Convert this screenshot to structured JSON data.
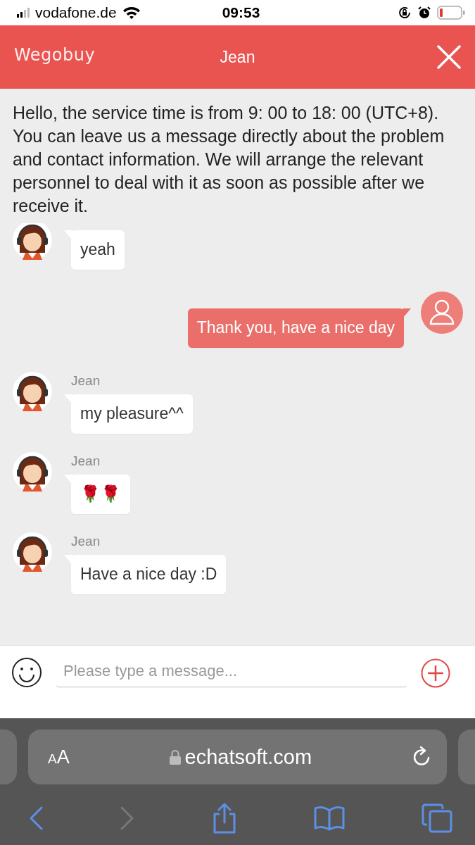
{
  "status_bar": {
    "carrier": "vodafone.de",
    "time": "09:53"
  },
  "header": {
    "logo": "Wegobuy",
    "title": "Jean"
  },
  "notice": "Hello, the service time is from 9: 00 to 18: 00 (UTC+8). You can leave us a message directly about the problem and contact information. We will arrange the relevant personnel to deal with it as soon as possible after we receive it.",
  "messages": [
    {
      "kind": "agent",
      "text": "yeah"
    },
    {
      "kind": "user",
      "text": "Thank you, have a nice day"
    },
    {
      "kind": "agent",
      "sender": "Jean",
      "text": "my pleasure^^"
    },
    {
      "kind": "agent",
      "sender": "Jean",
      "text": "🌹🌹"
    },
    {
      "kind": "agent",
      "sender": "Jean",
      "text": "Have a nice day :D"
    }
  ],
  "composer": {
    "placeholder": "Please type a message..."
  },
  "browser": {
    "text_size": "AA",
    "url": "echatsoft.com",
    "back_disabled": false,
    "forward_disabled": true
  }
}
